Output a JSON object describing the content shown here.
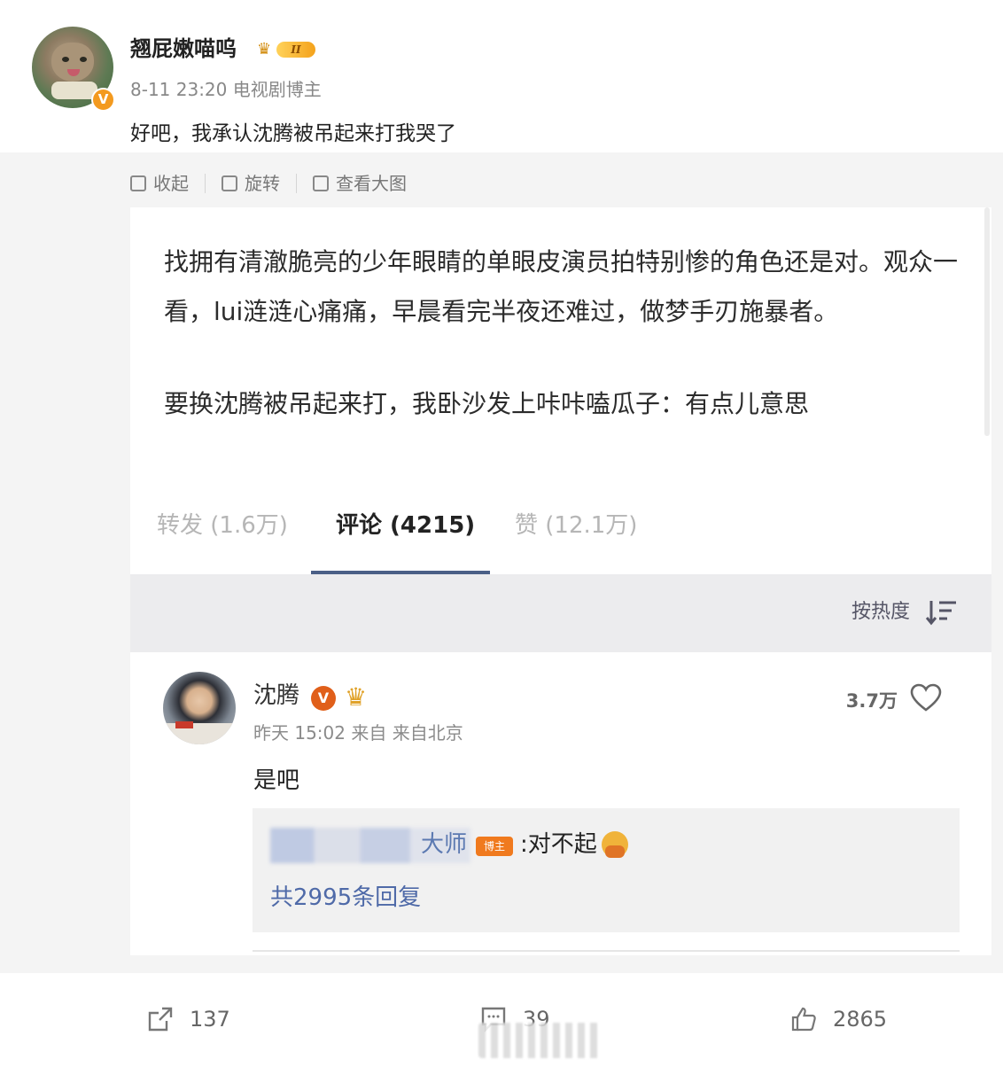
{
  "post": {
    "username": "翘屁嫩喵呜",
    "level_badge": "II",
    "meta": "8-11 23:20 电视剧博主",
    "text": "好吧，我承认沈腾被吊起来打我哭了",
    "verified_mark": "V"
  },
  "media_toolbar": {
    "collapse_label": "收起",
    "rotate_label": "旋转",
    "view_large_label": "查看大图"
  },
  "quoted_post": {
    "paragraph_1": "找拥有清澈脆亮的少年眼睛的单眼皮演员拍特别惨的角色还是对。观众一看，lui涟涟心痛痛，早晨看完半夜还难过，做梦手刃施暴者。",
    "paragraph_2": "要换沈腾被吊起来打，我卧沙发上咔咔嗑瓜子：有点儿意思"
  },
  "tabs": {
    "reposts": "转发 (1.6万)",
    "comments": "评论 (4215)",
    "likes": "赞 (12.1万)"
  },
  "sort": {
    "label": "按热度"
  },
  "comment": {
    "name": "沈腾",
    "verified_mark": "V",
    "time": "昨天 15:02 来自 来自北京",
    "likes": "3.7万",
    "text": "是吧",
    "reply": {
      "name_tail": "大师",
      "tag": "博主",
      "text": ":对不起",
      "count_label": "共2995条回复"
    }
  },
  "actions": {
    "reposts": "137",
    "comments": "39",
    "likes": "2865"
  },
  "colors": {
    "accent_blue": "#4a5f86",
    "reply_link": "#4f6aa8",
    "badge_orange": "#f39a1f"
  }
}
